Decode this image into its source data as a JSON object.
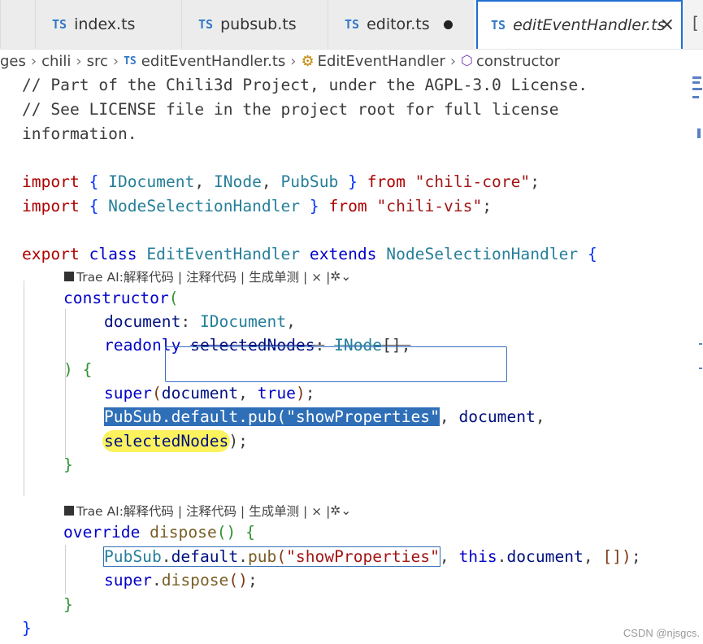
{
  "tabs": [
    {
      "lang": "TS",
      "label": "index.ts"
    },
    {
      "lang": "TS",
      "label": "pubsub.ts"
    },
    {
      "lang": "TS",
      "label": "editor.ts",
      "modified": true
    },
    {
      "lang": "TS",
      "label": "editEventHandler.ts",
      "active": true,
      "close": "×"
    }
  ],
  "tab_more": "[",
  "breadcrumb": {
    "parts": [
      "ges",
      "chili",
      "src"
    ],
    "file_lang": "TS",
    "file": "editEventHandler.ts",
    "class_name": "EditEventHandler",
    "method_name": "constructor"
  },
  "codelens": {
    "text": "Trae AI:解释代码 | 注释代码 | 生成单测 | × | ",
    "suffix": "⌄"
  },
  "code": {
    "line1": "// Part of the Chili3d Project, under the AGPL-3.0 License.",
    "line2": "// See LICENSE file in the project root for full license",
    "line3": "information.",
    "import": "import",
    "from": "from",
    "export": "export",
    "class": "class",
    "extends": "extends",
    "IDocument": "IDocument",
    "INode": "INode",
    "PubSub": "PubSub",
    "NodeSelectionHandler": "NodeSelectionHandler",
    "chili_core": "\"chili-core\"",
    "chili_vis": "\"chili-vis\"",
    "EditEventHandler": "EditEventHandler",
    "constructor": "constructor",
    "document": "document",
    "readonly": "readonly",
    "selectedNodes": "selectedNodes",
    "super": "super",
    "true": "true",
    "pub_call": "PubSub.default.pub(\"showProperties\"",
    "override": "override",
    "dispose": "dispose",
    "default": "default",
    "pub": "pub",
    "showProperties": "\"showProperties\"",
    "this": "this"
  },
  "watermark": "CSDN @njsgcs."
}
